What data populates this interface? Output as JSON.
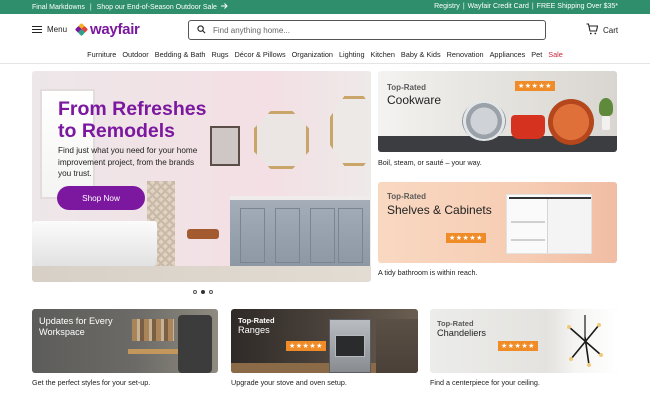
{
  "promo": {
    "left_a": "Final Markdowns",
    "left_sep": "|",
    "left_b": "Shop our End-of-Season Outdoor Sale",
    "links": [
      "Registry",
      "Wayfair Credit Card",
      "FREE Shipping Over $35*"
    ],
    "sep": "|",
    "arrow_icon": "arrow-right-icon"
  },
  "header": {
    "menu_label": "Menu",
    "logo_text": "wayfair",
    "search_placeholder": "Find anything home...",
    "cart_label": "Cart"
  },
  "categories": [
    "Furniture",
    "Outdoor",
    "Bedding & Bath",
    "Rugs",
    "Décor & Pillows",
    "Organization",
    "Lighting",
    "Kitchen",
    "Baby & Kids",
    "Renovation",
    "Appliances",
    "Pet",
    "Sale"
  ],
  "hero": {
    "title_line1": "From Refreshes",
    "title_line2": "to Remodels",
    "body": "Find just what you need for your home improvement project, from the brands you trust.",
    "button": "Shop Now",
    "carousel_total": 3,
    "carousel_active": 2
  },
  "tiles": {
    "cookware": {
      "kicker": "Top-Rated",
      "title": "Cookware",
      "rating": "★★★★★",
      "caption": "Boil, steam, or sauté – your way."
    },
    "shelves": {
      "kicker": "Top-Rated",
      "title": "Shelves & Cabinets",
      "rating": "★★★★★",
      "caption": "A tidy bathroom is within reach."
    },
    "workspace": {
      "title": "Updates for Every Workspace",
      "caption": "Get the perfect styles for your set-up."
    },
    "ranges": {
      "kicker": "Top-Rated",
      "title": "Ranges",
      "rating": "★★★★★",
      "caption": "Upgrade your stove and oven setup."
    },
    "chandeliers": {
      "kicker": "Top-Rated",
      "title": "Chandeliers",
      "rating": "★★★★★",
      "caption": "Find a centerpiece for your ceiling."
    }
  },
  "colors": {
    "promo_bg": "#2f8f6d",
    "brand_purple": "#7b189f",
    "sale_red": "#c6253b",
    "rating_orange": "#f08c28"
  }
}
